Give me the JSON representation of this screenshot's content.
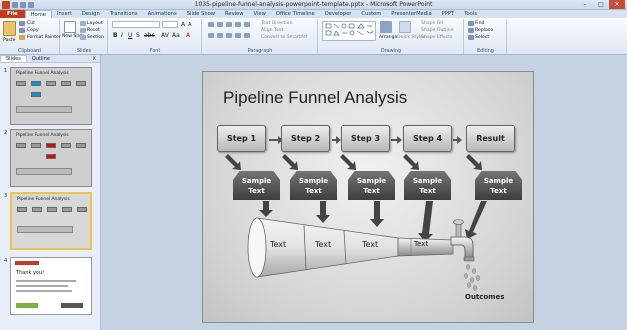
{
  "window": {
    "title": "1035-pipeline-funnel-analysis-powerpoint-template.pptx - Microsoft PowerPoint",
    "quick_access": [
      "save-icon",
      "undo-icon",
      "redo-icon"
    ],
    "controls": [
      "minimize",
      "maximize",
      "close"
    ]
  },
  "ribbon_tabs": [
    "File",
    "Home",
    "Insert",
    "Design",
    "Transitions",
    "Animations",
    "Slide Show",
    "Review",
    "View",
    "Office Timeline",
    "Developer",
    "Custom",
    "PresenterMedia",
    "PPPT",
    "Tools"
  ],
  "ribbon": {
    "clipboard": {
      "label": "Clipboard",
      "paste": "Paste",
      "cut": "Cut",
      "copy": "Copy",
      "format_painter": "Format Painter"
    },
    "slides": {
      "label": "Slides",
      "new_slide": "New Slide",
      "layout": "Layout",
      "reset": "Reset",
      "section": "Section"
    },
    "font": {
      "label": "Font"
    },
    "paragraph": {
      "label": "Paragraph",
      "text_direction": "Text Direction",
      "align_text": "Align Text",
      "convert_smartart": "Convert to SmartArt"
    },
    "drawing": {
      "label": "Drawing",
      "arrange": "Arrange",
      "quick_styles": "Quick Styles",
      "shape_fill": "Shape Fill",
      "shape_outline": "Shape Outline",
      "shape_effects": "Shape Effects"
    },
    "editing": {
      "label": "Editing",
      "find": "Find",
      "replace": "Replace",
      "select": "Select"
    }
  },
  "panel": {
    "tabs": [
      "Slides",
      "Outline"
    ],
    "close": "x",
    "thumbnails": [
      {
        "num": "1",
        "title": "Pipeline Funnel Analysis"
      },
      {
        "num": "2",
        "title": "Pipeline Funnel Analysis"
      },
      {
        "num": "3",
        "title": "Pipeline Funnel Analysis"
      },
      {
        "num": "4",
        "title": "Thank you!"
      }
    ]
  },
  "slide": {
    "title": "Pipeline Funnel Analysis",
    "steps": [
      "Step 1",
      "Step 2",
      "Step 3",
      "Step 4",
      "Result"
    ],
    "samples": [
      "Sample\nText",
      "Sample\nText",
      "Sample\nText",
      "Sample\nText",
      "Sample\nText"
    ],
    "funnel_labels": [
      "Text",
      "Text",
      "Text",
      "Text"
    ],
    "outcomes": "Outcomes"
  },
  "colors": {
    "file_tab": "#c43c1d",
    "selected_thumb": "#f0c24a",
    "thumb2_accent": "#d01010",
    "thumb1_accent": "#1a8fd0"
  }
}
